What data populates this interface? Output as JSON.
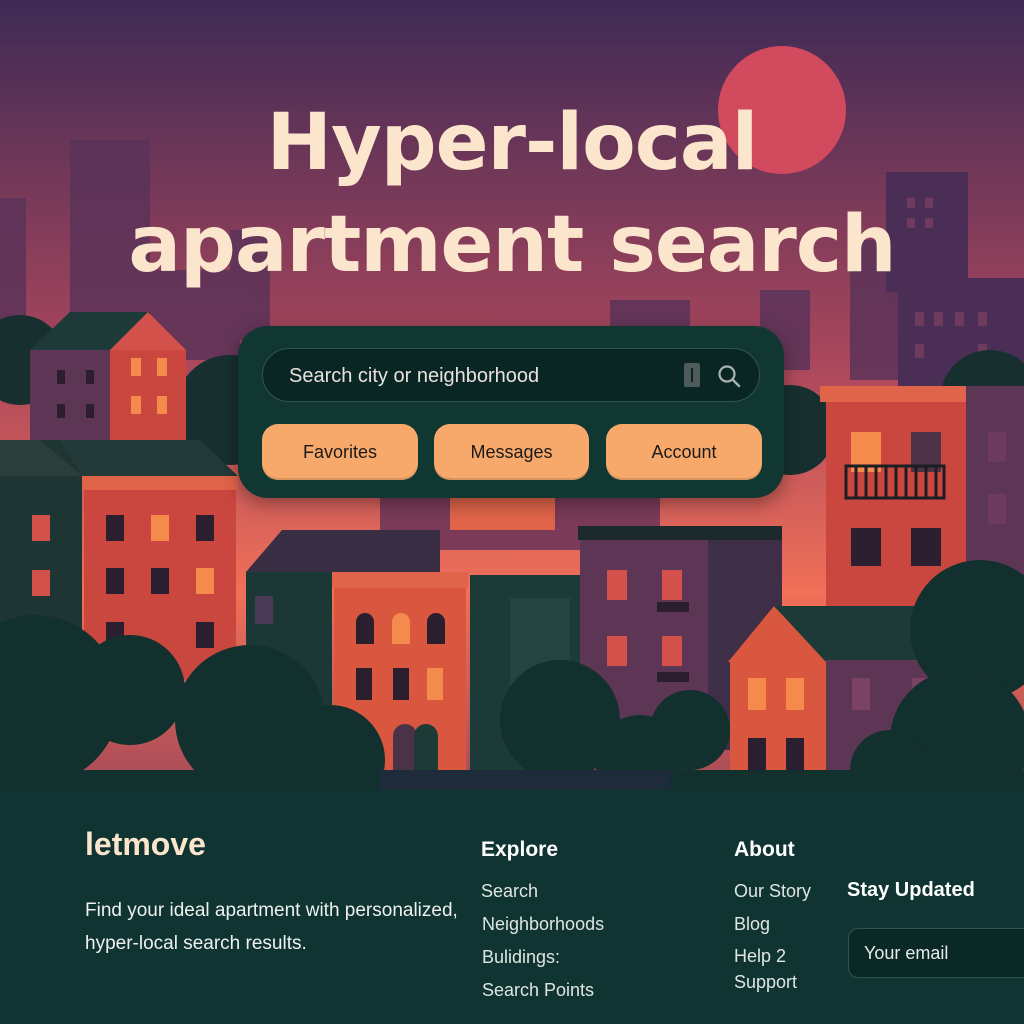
{
  "hero": {
    "title_line1": "Hyper-local",
    "title_line2": "apartment search"
  },
  "search": {
    "placeholder": "Search city or neighborhood",
    "search_icon": "search-icon"
  },
  "actions": {
    "favorites": "Favorites",
    "messages": "Messages",
    "account": "Account"
  },
  "footer": {
    "brand": "letmove",
    "tagline": "Find your ideal apartment with personalized, hyper-local search results.",
    "explore": {
      "title": "Explore",
      "links": [
        "Search",
        "Neighborhoods",
        "Bulidings:",
        "Search Points"
      ]
    },
    "about": {
      "title": "About",
      "links": [
        "Our Story",
        "Blog",
        "Help 2",
        "Support"
      ]
    },
    "newsletter": {
      "title": "Stay Updated",
      "email_placeholder": "Your email"
    }
  },
  "colors": {
    "sky_top": "#3e2a55",
    "sky_bottom": "#f07058",
    "sun": "#d24a5e",
    "title": "#fbe5cc",
    "panel": "#113733",
    "button": "#f7a96b",
    "footer_bg": "#0f3431"
  }
}
